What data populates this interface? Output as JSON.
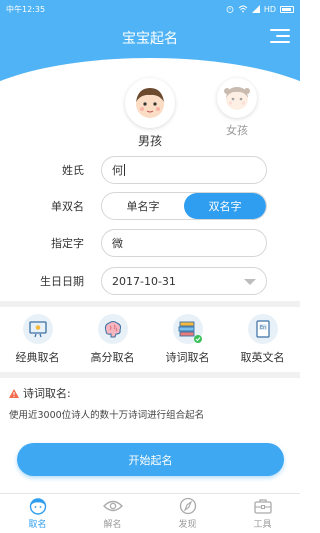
{
  "status_bar": {
    "time": "中午12:35",
    "network": "HD"
  },
  "header": {
    "title": "宝宝起名"
  },
  "gender": {
    "boy_label": "男孩",
    "girl_label": "女孩"
  },
  "form": {
    "surname_label": "姓氏",
    "surname_value": "何",
    "name_type_label": "单双名",
    "single_label": "单名字",
    "double_label": "双名字",
    "selected": "双名字",
    "fixed_char_label": "指定字",
    "fixed_char_value": "微",
    "birthday_label": "生日日期",
    "birthday_value": "2017-10-31"
  },
  "categories": [
    {
      "label": "经典取名",
      "icon": "certificate-icon"
    },
    {
      "label": "高分取名",
      "icon": "brain-icon"
    },
    {
      "label": "诗词取名",
      "icon": "books-icon"
    },
    {
      "label": "取英文名",
      "icon": "english-book-icon"
    }
  ],
  "info": {
    "title": "诗词取名:",
    "description": "使用近3000位诗人的数十万诗词进行组合起名"
  },
  "start_button": "开始起名",
  "nav": [
    {
      "label": "取名",
      "icon": "baby-face-icon",
      "active": true
    },
    {
      "label": "解名",
      "icon": "eye-icon",
      "active": false
    },
    {
      "label": "发现",
      "icon": "compass-icon",
      "active": false
    },
    {
      "label": "工具",
      "icon": "toolbox-icon",
      "active": false
    }
  ],
  "colors": {
    "accent": "#2f9ef0",
    "header": "#4fb3f5",
    "warning": "#f26b4c"
  }
}
